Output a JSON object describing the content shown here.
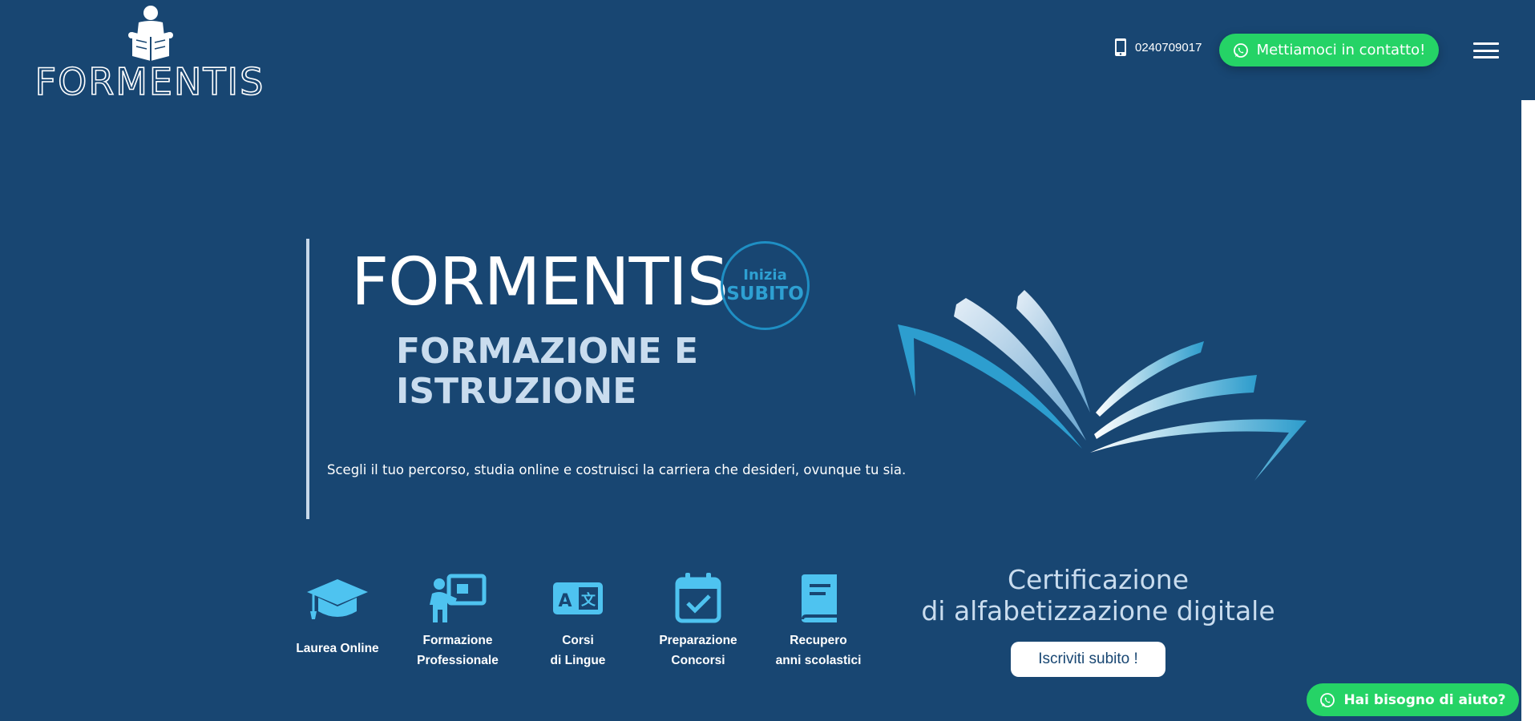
{
  "header": {
    "logo_text": "FORMENTIS",
    "phone": "0240709017",
    "contact_label": "Mettiamoci in contatto!"
  },
  "hero": {
    "title": "FORMENTIS",
    "cta_top": "Inizia",
    "cta_bottom": "SUBITO",
    "subtitle": "FORMAZIONE E ISTRUZIONE",
    "description": "Scegli il tuo percorso, studia online e costruisci la carriera che desideri, ovunque tu sia."
  },
  "services": [
    {
      "label": "Laurea Online",
      "icon": "graduation-cap-icon"
    },
    {
      "label": "Formazione\nProfessionale",
      "icon": "teacher-board-icon"
    },
    {
      "label": "Corsi\ndi Lingue",
      "icon": "language-icon"
    },
    {
      "label": "Preparazione\nConcorsi",
      "icon": "calendar-check-icon"
    },
    {
      "label": "Recupero\nanni scolastici",
      "icon": "book-icon"
    }
  ],
  "certification": {
    "title": "Certificazione\ndi alfabetizzazione digitale",
    "button_label": "Iscriviti subito !"
  },
  "help": {
    "label": "Hai bisogno di aiuto?"
  },
  "colors": {
    "background": "#184672",
    "whatsapp_green": "#25d366",
    "accent_blue": "#2ea0d2",
    "icon_blue": "#4ec3f0"
  }
}
